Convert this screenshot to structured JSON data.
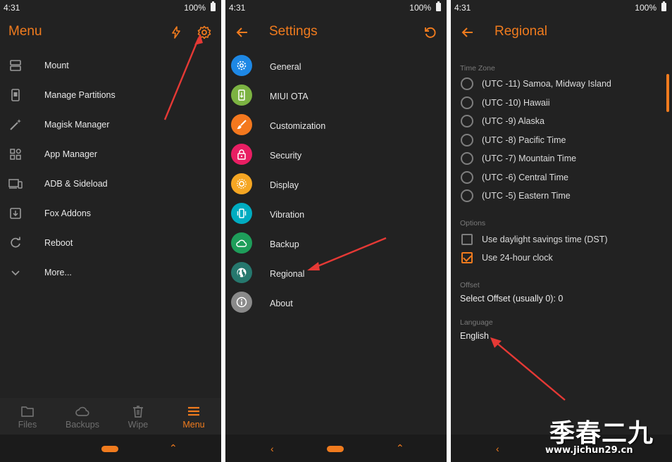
{
  "colors": {
    "accent": "#f07b1e",
    "background": "#222222",
    "text": "#e6e6e6",
    "muted": "#7a7a7a",
    "arrow": "#e53935"
  },
  "status": {
    "time": "4:31",
    "battery": "100%"
  },
  "menu_screen": {
    "title": "Menu",
    "header_icons": [
      "flash-icon",
      "gear-icon"
    ],
    "items": [
      {
        "label": "Mount",
        "icon": "storage-icon"
      },
      {
        "label": "Manage Partitions",
        "icon": "phone-icon"
      },
      {
        "label": "Magisk Manager",
        "icon": "magic-wand-icon"
      },
      {
        "label": "App Manager",
        "icon": "apps-grid-icon"
      },
      {
        "label": "ADB & Sideload",
        "icon": "devices-icon"
      },
      {
        "label": "Fox Addons",
        "icon": "addon-icon"
      },
      {
        "label": "Reboot",
        "icon": "reboot-icon"
      },
      {
        "label": "More...",
        "icon": "chevron-down-icon"
      }
    ],
    "tabs": [
      {
        "label": "Files",
        "icon": "folder-icon",
        "active": false
      },
      {
        "label": "Backups",
        "icon": "cloud-icon",
        "active": false
      },
      {
        "label": "Wipe",
        "icon": "trash-icon",
        "active": false
      },
      {
        "label": "Menu",
        "icon": "hamburger-icon",
        "active": true
      }
    ]
  },
  "settings_screen": {
    "title": "Settings",
    "items": [
      {
        "label": "General",
        "icon": "gear-icon",
        "color": "#1e88e5"
      },
      {
        "label": "MIUI OTA",
        "icon": "phone-update-icon",
        "color": "#7cb342"
      },
      {
        "label": "Customization",
        "icon": "brush-icon",
        "color": "#f4781e"
      },
      {
        "label": "Security",
        "icon": "lock-icon",
        "color": "#e91e63"
      },
      {
        "label": "Display",
        "icon": "brightness-icon",
        "color": "#f5a623"
      },
      {
        "label": "Vibration",
        "icon": "vibration-icon",
        "color": "#00acc1"
      },
      {
        "label": "Backup",
        "icon": "cloud-icon",
        "color": "#1e9e5a"
      },
      {
        "label": "Regional",
        "icon": "globe-icon",
        "color": "#26786e"
      },
      {
        "label": "About",
        "icon": "info-icon",
        "color": "#8a8a8a"
      }
    ]
  },
  "regional_screen": {
    "title": "Regional",
    "time_zone_label": "Time Zone",
    "time_zones": [
      "(UTC -11) Samoa, Midway Island",
      "(UTC -10) Hawaii",
      "(UTC -9) Alaska",
      "(UTC -8) Pacific Time",
      "(UTC -7) Mountain Time",
      "(UTC -6) Central Time",
      "(UTC -5) Eastern Time"
    ],
    "options_label": "Options",
    "options": [
      {
        "label": "Use daylight savings time (DST)",
        "checked": false
      },
      {
        "label": "Use 24-hour clock",
        "checked": true
      }
    ],
    "offset_label": "Offset",
    "offset_value": "Select Offset (usually 0): 0",
    "language_label": "Language",
    "language_value": "English"
  },
  "watermark": {
    "text_cn": "季春二九",
    "url": "www.jichun29.cn"
  }
}
